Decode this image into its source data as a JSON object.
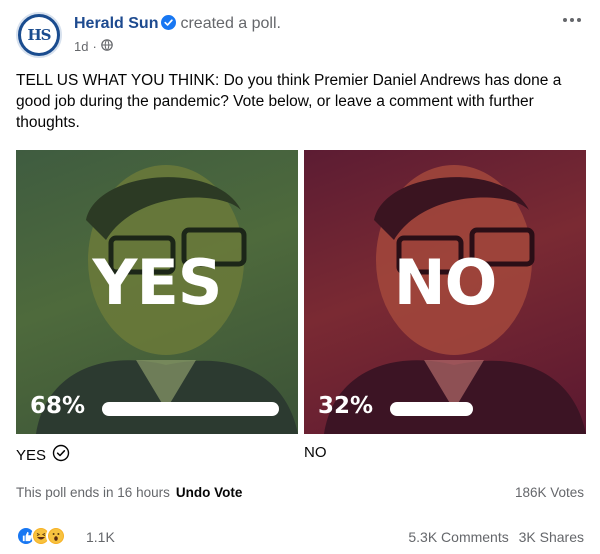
{
  "post": {
    "page_name": "Herald Sun",
    "avatar_text": "HS",
    "action": "created a poll.",
    "time": "1d",
    "privacy_icon": "globe-icon",
    "menu_icon": "more-options-icon",
    "body": "TELL US WHAT YOU THINK: Do you think Premier Daniel Andrews has done a good job during the pandemic? Vote below, or leave a comment with further thoughts."
  },
  "poll": {
    "options": [
      {
        "overlay_text": "YES",
        "percent_label": "68%",
        "percent": 68,
        "label": "YES",
        "selected": true,
        "tint": "#4e6a3c"
      },
      {
        "overlay_text": "NO",
        "percent_label": "32%",
        "percent": 32,
        "label": "NO",
        "selected": false,
        "tint": "#7a2a33"
      }
    ],
    "ends_text": "This poll ends in 16 hours",
    "undo_label": "Undo Vote",
    "votes_text": "186K Votes"
  },
  "engagement": {
    "reaction_icons": [
      "like-icon",
      "haha-icon",
      "wow-icon"
    ],
    "reaction_count": "1.1K",
    "comments": "5.3K Comments",
    "shares": "3K Shares"
  },
  "colors": {
    "brand": "#1d4a8f",
    "verified": "#1877f2",
    "muted_text": "#65676b"
  }
}
